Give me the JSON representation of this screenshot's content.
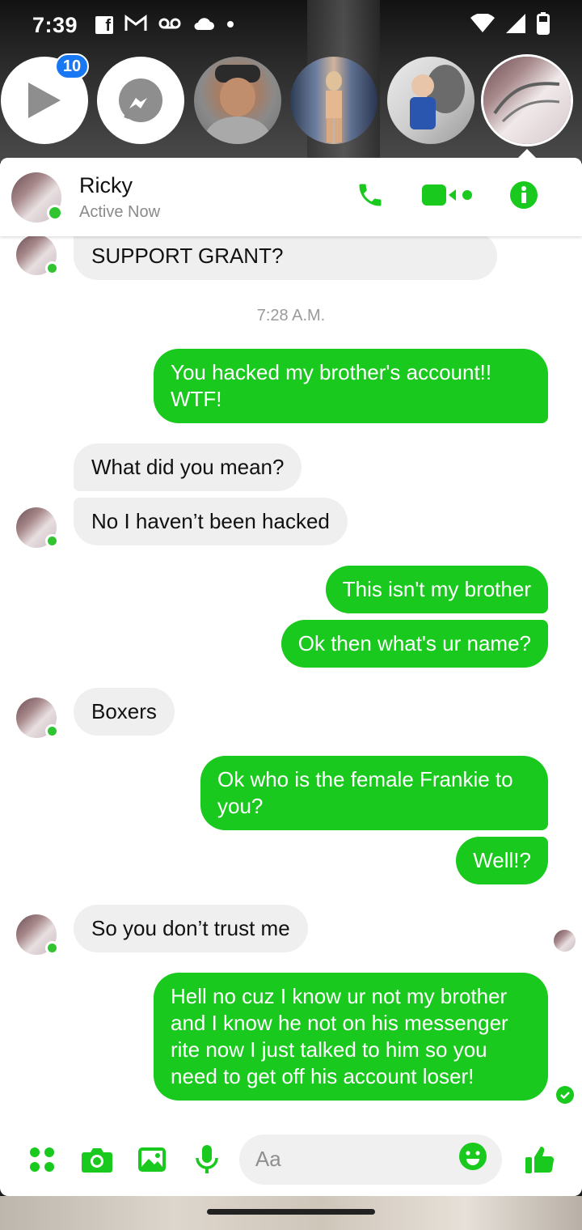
{
  "status_bar": {
    "time": "7:39",
    "icons": [
      "facebook-icon",
      "gmail-icon",
      "voicemail-icon",
      "cloud-icon",
      "dot-icon",
      "wifi-icon",
      "signal-icon",
      "battery-icon"
    ]
  },
  "chat_heads": {
    "badge_count": "10",
    "items": [
      {
        "name": "play-video-head"
      },
      {
        "name": "messenger-head"
      },
      {
        "name": "contact-head-1"
      },
      {
        "name": "contact-head-2"
      },
      {
        "name": "contact-head-3"
      },
      {
        "name": "contact-head-active"
      }
    ]
  },
  "header": {
    "name": "Ricky",
    "status": "Active Now",
    "actions": [
      "phone-icon",
      "video-call-icon",
      "info-icon"
    ]
  },
  "messages": [
    {
      "dir": "in",
      "text": "SUPPORT GRANT?"
    },
    {
      "dir": "time",
      "text": "7:28 A.M."
    },
    {
      "dir": "out",
      "text": "You hacked my brother's account!! WTF!"
    },
    {
      "dir": "in",
      "text": "What did you mean?"
    },
    {
      "dir": "in",
      "text": "No I haven’t been hacked"
    },
    {
      "dir": "out",
      "text": "This isn't my brother"
    },
    {
      "dir": "out",
      "text": "Ok then what's ur name?"
    },
    {
      "dir": "in",
      "text": "Boxers"
    },
    {
      "dir": "out",
      "text": "Ok who is the female Frankie to you?"
    },
    {
      "dir": "out",
      "text": "Well!?"
    },
    {
      "dir": "in",
      "text": "So you don’t trust me"
    },
    {
      "dir": "out",
      "text": "Hell no cuz I know ur not my brother and I know he not on his messenger rite now I just talked to him so you need to get off his account loser!"
    }
  ],
  "composer": {
    "placeholder": "Aa",
    "icons": [
      "apps-icon",
      "camera-icon",
      "gallery-icon",
      "microphone-icon",
      "emoji-icon",
      "thumbs-up-icon"
    ]
  },
  "colors": {
    "accent": "#19c91d",
    "incoming_bubble": "#efefef",
    "badge": "#1877f2",
    "online": "#31c431"
  }
}
